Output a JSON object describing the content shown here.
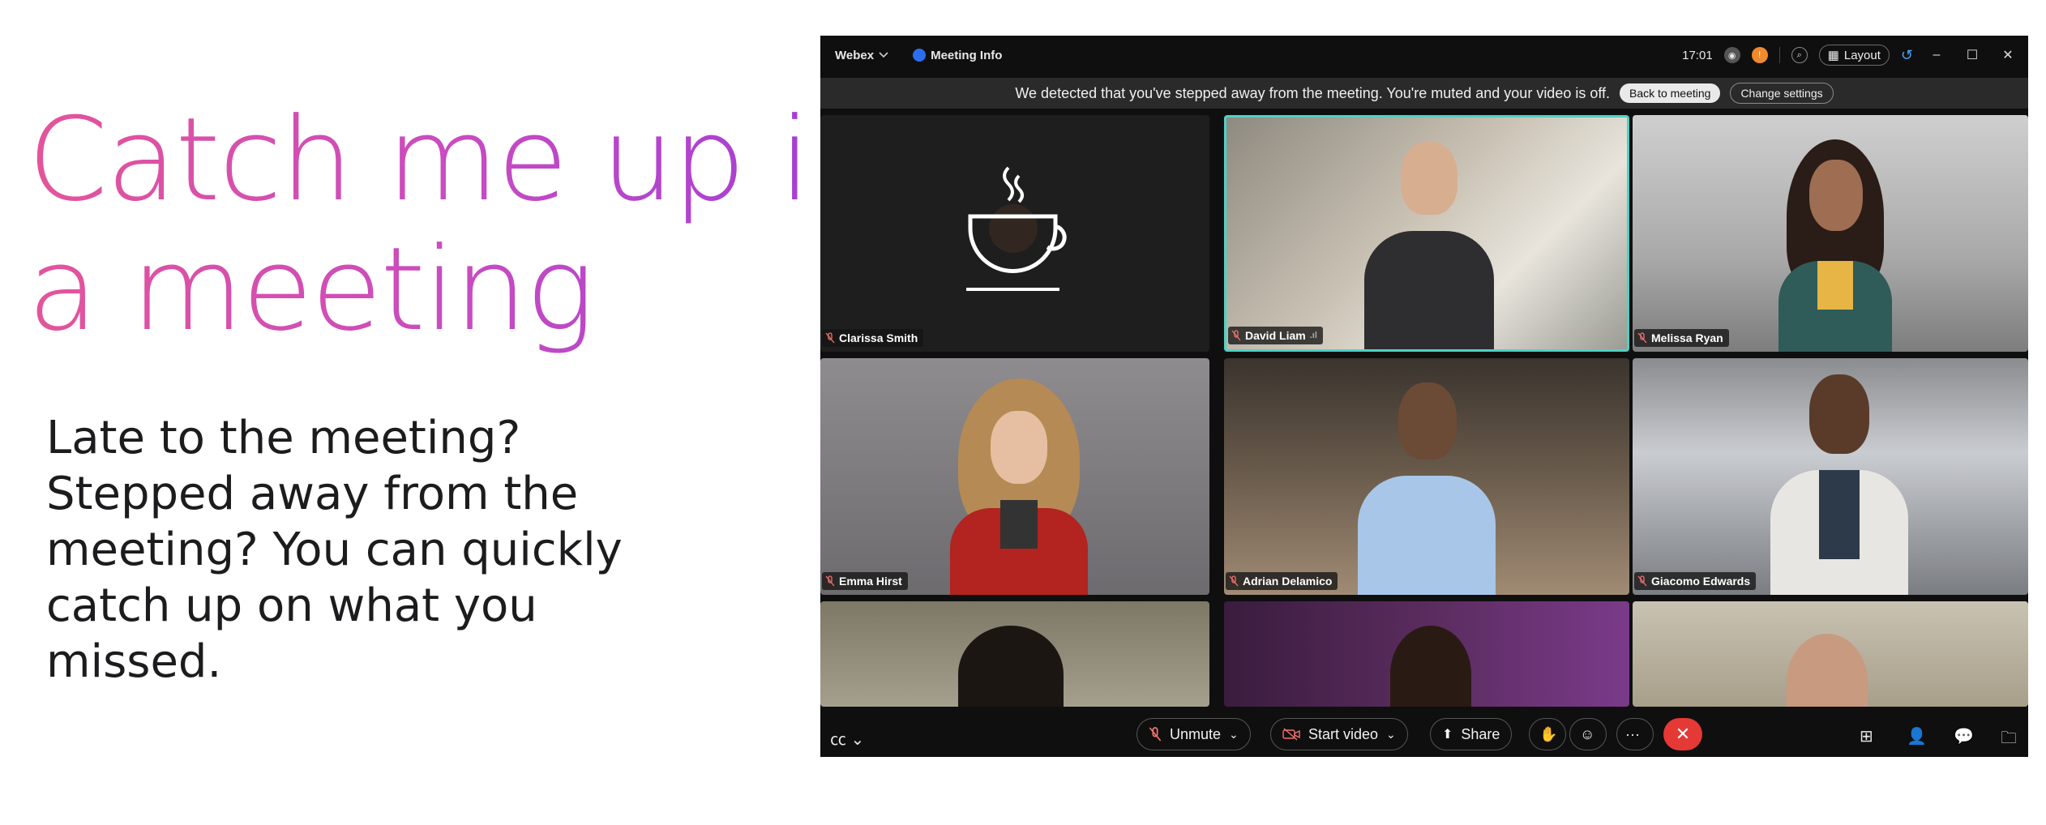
{
  "slide": {
    "headline_line1": "Catch me up in",
    "headline_line2": "a meeting",
    "body": "Late to the meeting? Stepped away from the meeting? You can quickly catch up on what you missed.",
    "headline_gradient": [
      "#e4549a",
      "#c84bc2",
      "#a43fd4"
    ]
  },
  "titlebar": {
    "app": "Webex",
    "meeting_info": "Meeting Info",
    "time": "17:01",
    "layout": "Layout"
  },
  "banner": {
    "message": "We detected that you've stepped away from the meeting. You're muted and your video is off.",
    "back_button": "Back to meeting",
    "settings_button": "Change settings"
  },
  "participants": [
    {
      "name": "Clarissa Smith",
      "muted": true,
      "video": false,
      "icon": "coffee-cup-icon"
    },
    {
      "name": "David Liam",
      "muted": true,
      "video": true,
      "active_speaker": true
    },
    {
      "name": "Melissa Ryan",
      "muted": true,
      "video": true
    },
    {
      "name": "Emma Hirst",
      "muted": true,
      "video": true
    },
    {
      "name": "Adrian Delamico",
      "muted": true,
      "video": true
    },
    {
      "name": "Giacomo Edwards",
      "muted": true,
      "video": true
    },
    {
      "name": "",
      "video": true
    },
    {
      "name": "",
      "video": true
    },
    {
      "name": "",
      "video": true
    }
  ],
  "controls": {
    "unmute": "Unmute",
    "start_video": "Start video",
    "share": "Share",
    "more": "···"
  },
  "colors": {
    "window_bg": "#0f0f0f",
    "active_speaker_border": "#4fd1c5",
    "end_call": "#e53935"
  }
}
